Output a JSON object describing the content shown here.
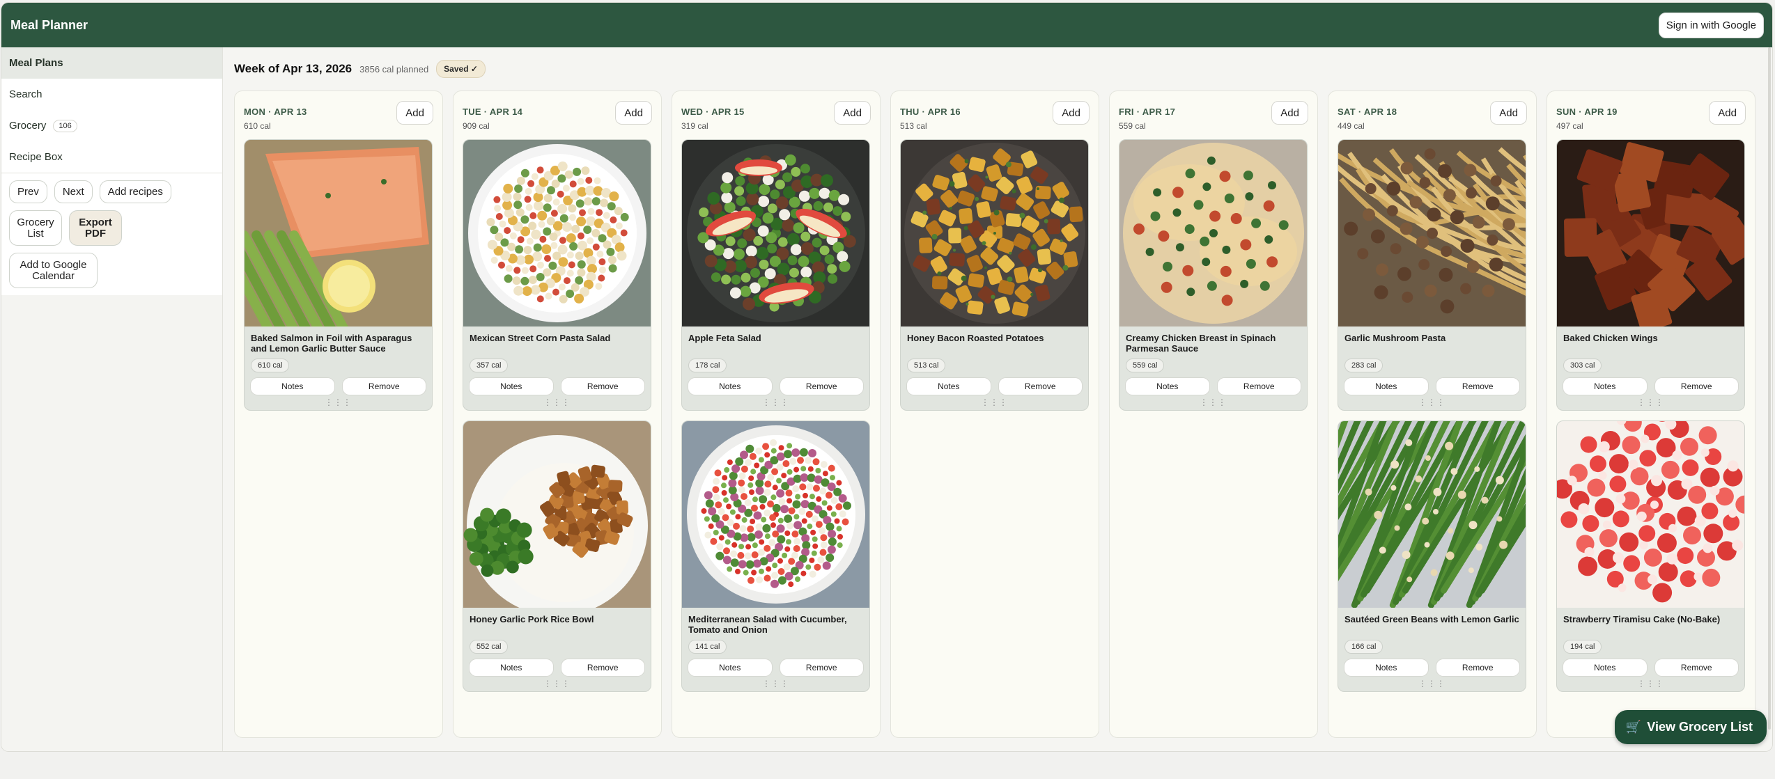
{
  "app": {
    "title": "Meal Planner",
    "sign_in_label": "Sign in with Google"
  },
  "sidebar": {
    "nav": [
      {
        "label": "Meal Plans",
        "badge": ""
      },
      {
        "label": "Search",
        "badge": ""
      },
      {
        "label": "Grocery",
        "badge": "106"
      },
      {
        "label": "Recipe Box",
        "badge": ""
      }
    ],
    "tools": {
      "prev": "Prev",
      "next": "Next",
      "add_recipes": "Add recipes",
      "grocery_list": "Grocery List",
      "export_pdf": "Export PDF",
      "add_calendar": "Add to Google Calendar"
    }
  },
  "week": {
    "title": "Week of Apr 13, 2026",
    "calories": "3856 cal planned",
    "status": "Saved ✓"
  },
  "buttons": {
    "add": "Add",
    "notes": "Notes",
    "remove": "Remove",
    "grip": "⋮⋮⋮"
  },
  "days": [
    {
      "label": "MON · APR 13",
      "cal": "610 cal",
      "recipes": [
        {
          "title": "Baked Salmon in Foil with Asparagus and Lemon Garlic Butter Sauce",
          "cal": "610 cal",
          "image": "salmon"
        }
      ]
    },
    {
      "label": "TUE · APR 14",
      "cal": "909 cal",
      "recipes": [
        {
          "title": "Mexican Street Corn Pasta Salad",
          "cal": "357 cal",
          "image": "pasta-salad"
        },
        {
          "title": "Honey Garlic Pork Rice Bowl",
          "cal": "552 cal",
          "image": "pork-bowl"
        }
      ]
    },
    {
      "label": "WED · APR 15",
      "cal": "319 cal",
      "recipes": [
        {
          "title": "Apple Feta Salad",
          "cal": "178 cal",
          "image": "apple-salad"
        },
        {
          "title": "Mediterranean Salad with Cucumber, Tomato and Onion",
          "cal": "141 cal",
          "image": "med-salad"
        }
      ]
    },
    {
      "label": "THU · APR 16",
      "cal": "513 cal",
      "recipes": [
        {
          "title": "Honey Bacon Roasted Potatoes",
          "cal": "513 cal",
          "image": "potatoes"
        }
      ]
    },
    {
      "label": "FRI · APR 17",
      "cal": "559 cal",
      "recipes": [
        {
          "title": "Creamy Chicken Breast in Spinach Parmesan Sauce",
          "cal": "559 cal",
          "image": "creamy-chicken"
        }
      ]
    },
    {
      "label": "SAT · APR 18",
      "cal": "449 cal",
      "recipes": [
        {
          "title": "Garlic Mushroom Pasta",
          "cal": "283 cal",
          "image": "mushroom-pasta"
        },
        {
          "title": "Sautéed Green Beans with Lemon Garlic",
          "cal": "166 cal",
          "image": "green-beans"
        }
      ]
    },
    {
      "label": "SUN · APR 19",
      "cal": "497 cal",
      "recipes": [
        {
          "title": "Baked Chicken Wings",
          "cal": "303 cal",
          "image": "wings"
        },
        {
          "title": "Strawberry Tiramisu Cake (No-Bake)",
          "cal": "194 cal",
          "image": "tiramisu"
        }
      ]
    }
  ],
  "fab": {
    "icon": "cart-icon",
    "label": "View Grocery List"
  }
}
